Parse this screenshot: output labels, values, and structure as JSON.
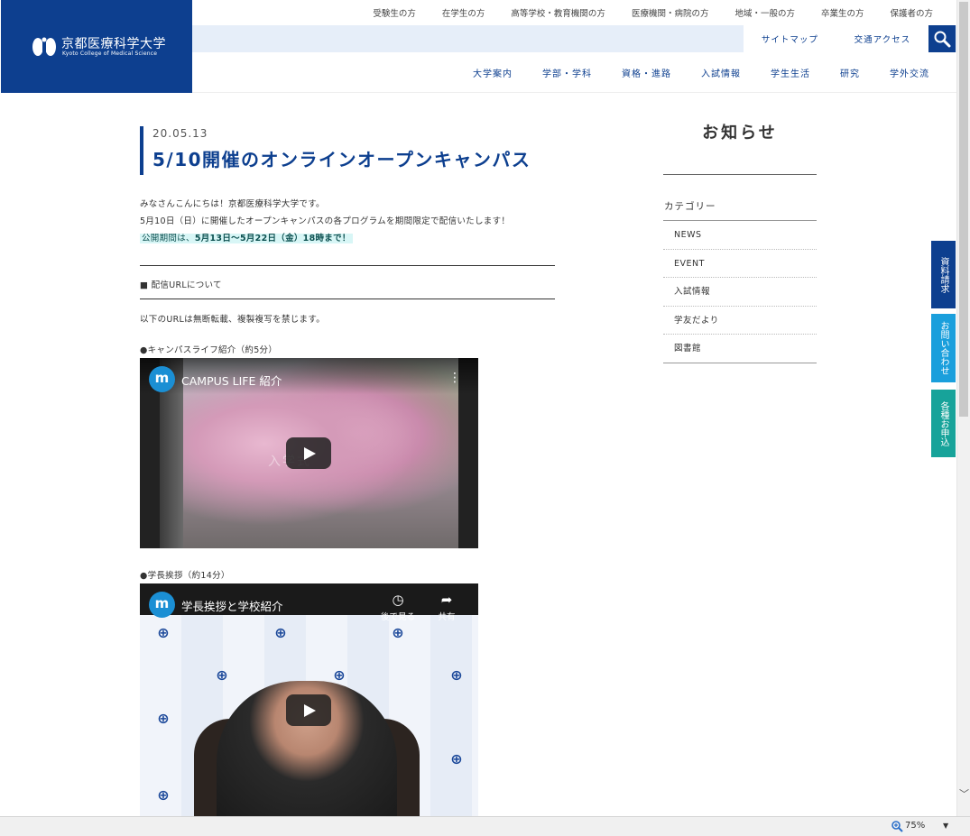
{
  "header": {
    "logo_jp": "京都医療科学大学",
    "logo_en": "Kyoto College of Medical Science",
    "top_links": [
      "受験生の方",
      "在学生の方",
      "高等学校・教育機関の方",
      "医療機関・病院の方",
      "地域・一般の方",
      "卒業生の方",
      "保護者の方"
    ],
    "util_links": [
      "サイトマップ",
      "交通アクセス"
    ],
    "search_icon": "search-icon",
    "main_nav": [
      "大学案内",
      "学部・学科",
      "資格・進路",
      "入試情報",
      "学生生活",
      "研究",
      "学外交流"
    ]
  },
  "article": {
    "date": "20.05.13",
    "title": "5/10開催のオンラインオープンキャンパス",
    "p1": "みなさんこんにちは！京都医療科学大学です。",
    "p2": "5月10日（日）に開催したオープンキャンパスの各プログラムを期間限定で配信いたします！",
    "highlight_prefix": "公開期間は、",
    "highlight_bold": "5月13日～5月22日（金）18時まで！",
    "section_heading": "■ 配信URLについて",
    "notice": "以下のURLは無断転載、複製複写を禁じます。",
    "video1_label": "●キャンパスライフ紹介（約5分）",
    "video2_label": "●学長挨拶（約14分）"
  },
  "videos": [
    {
      "channel_initial": "m",
      "title": "CAMPUS LIFE 紹介",
      "overlay_text": "入学式"
    },
    {
      "channel_initial": "m",
      "title": "学長挨拶と学校紹介",
      "watch_later": "後で見る",
      "share": "共有"
    }
  ],
  "sidebar": {
    "title": "お知らせ",
    "category_label": "カテゴリー",
    "categories": [
      "NEWS",
      "EVENT",
      "入試情報",
      "学友だより",
      "図書館"
    ]
  },
  "side_tabs": [
    "資料請求",
    "お問い合わせ",
    "各種お申込み"
  ],
  "status_bar": {
    "zoom": "75%"
  },
  "colors": {
    "brand_navy": "#0d3f8f",
    "tab_blue": "#1a9fdc",
    "tab_teal": "#17a39a",
    "highlight_bg": "#d8f6f6"
  }
}
